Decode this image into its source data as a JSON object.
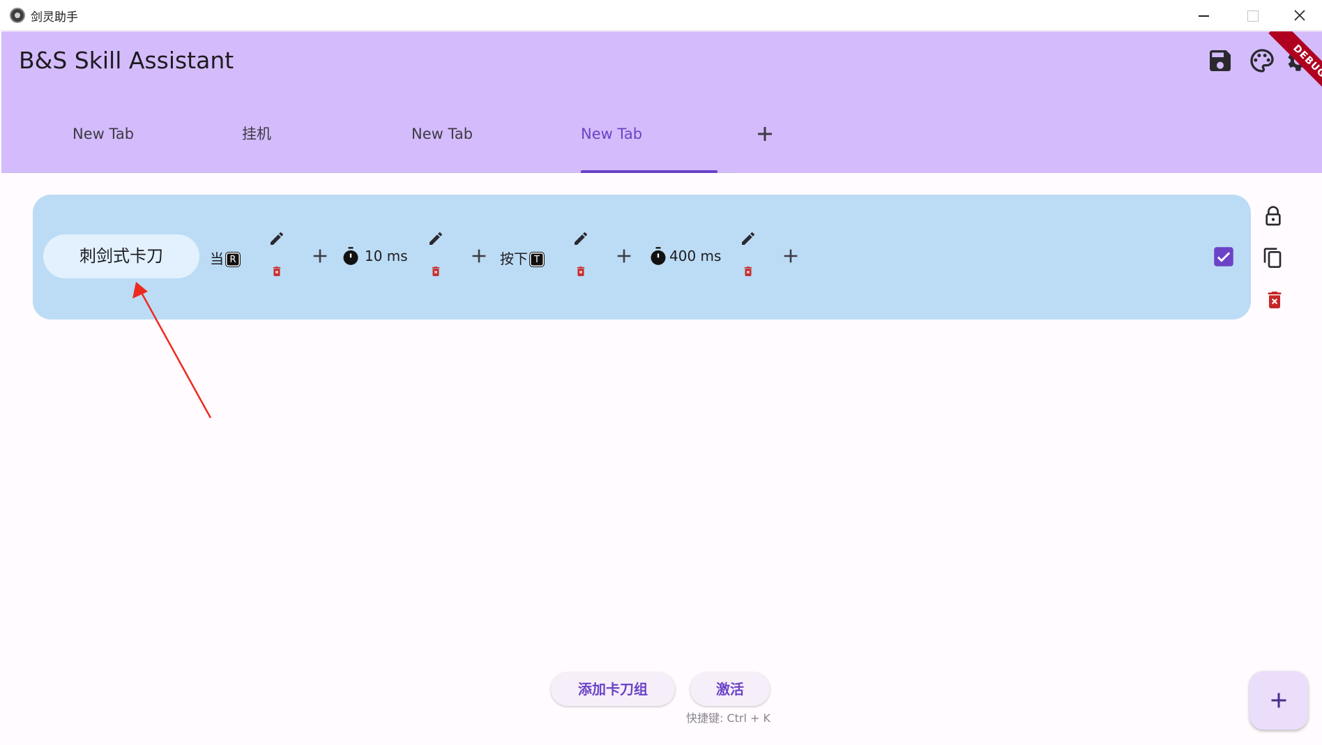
{
  "window": {
    "title": "剑灵助手",
    "controls": [
      "minimize-icon",
      "maximize-icon",
      "close-icon"
    ]
  },
  "appbar": {
    "title": "B&S Skill Assistant",
    "actions": [
      "save-icon",
      "palette-icon",
      "gear-icon"
    ],
    "debug_banner": "DEBUG"
  },
  "tabs": {
    "items": [
      {
        "label": "New Tab",
        "selected": false
      },
      {
        "label": "挂机",
        "selected": false
      },
      {
        "label": "New Tab",
        "selected": false
      },
      {
        "label": "New Tab",
        "selected": true
      }
    ],
    "add_icon": "plus-icon"
  },
  "combo": {
    "name": "刺剑式卡刀",
    "steps": [
      {
        "type": "trigger",
        "label": "当",
        "key": "R"
      },
      {
        "type": "delay",
        "label": "10 ms"
      },
      {
        "type": "press",
        "label": "按下",
        "key": "T"
      },
      {
        "type": "delay",
        "label": "400 ms"
      }
    ],
    "enabled": true,
    "side_actions": [
      "lock-icon",
      "copy-icon",
      "delete-icon"
    ]
  },
  "bottom": {
    "add_group_label": "添加卡刀组",
    "activate_label": "激活",
    "shortcut_hint": "快捷键: Ctrl + K"
  },
  "colors": {
    "appbar": "#d4bcfc",
    "accent": "#6b43c6",
    "card": "#bcdcf5",
    "delete": "#c62828",
    "annotation_arrow": "#ee2a1f"
  }
}
